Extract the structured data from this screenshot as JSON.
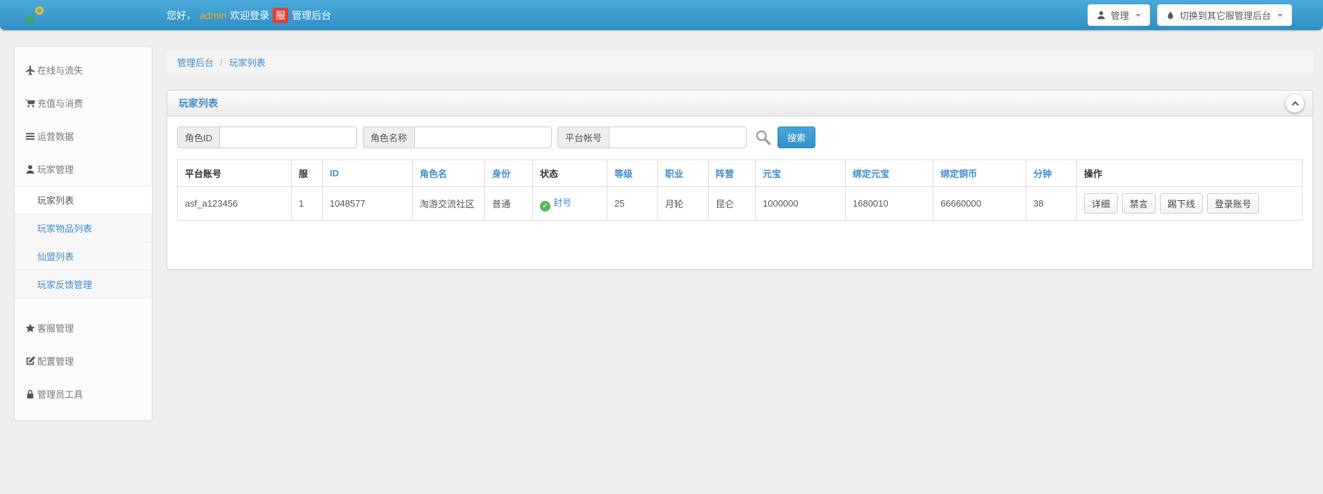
{
  "colors": {
    "navbar_blue_top": "#4aa9da",
    "navbar_blue_bottom": "#3090c5",
    "link_blue": "#428bca",
    "username_orange": "#f6a623",
    "server_badge_red": "#dd3f38",
    "status_green": "#5cb85c",
    "search_button_blue": "#3391c9"
  },
  "navbar": {
    "welcome": {
      "greeting": "您好，",
      "username": "admin",
      "message": "欢迎登录",
      "server_badge": "服",
      "suffix": "管理后台"
    },
    "manage_button": "管理",
    "switch_server_button": "切换到其它服管理后台"
  },
  "sidebar": {
    "items_top": [
      {
        "label": "在线与流失",
        "icon": "plane-icon"
      },
      {
        "label": "充值与消费",
        "icon": "cart-icon"
      },
      {
        "label": "运营数据",
        "icon": "list-icon"
      },
      {
        "label": "玩家管理",
        "icon": "user-icon"
      }
    ],
    "submenu": [
      {
        "label": "玩家列表",
        "active": true
      },
      {
        "label": "玩家物品列表",
        "active": false
      },
      {
        "label": "仙盟列表",
        "active": false
      },
      {
        "label": "玩家反馈管理",
        "active": false
      }
    ],
    "items_bottom": [
      {
        "label": "客服管理",
        "icon": "star-icon"
      },
      {
        "label": "配置管理",
        "icon": "edit-icon"
      },
      {
        "label": "管理员工具",
        "icon": "lock-icon"
      }
    ]
  },
  "breadcrumb": {
    "root": "管理后台",
    "separator": "/",
    "current": "玩家列表"
  },
  "panel": {
    "title": "玩家列表"
  },
  "search": {
    "fields": [
      {
        "label": "角色ID",
        "value": ""
      },
      {
        "label": "角色名称",
        "value": ""
      },
      {
        "label": "平台帐号",
        "value": ""
      }
    ],
    "button_label": "搜索"
  },
  "table": {
    "columns": [
      {
        "label": "平台账号",
        "link": false
      },
      {
        "label": "服",
        "link": false
      },
      {
        "label": "ID",
        "link": true
      },
      {
        "label": "角色名",
        "link": true
      },
      {
        "label": "身份",
        "link": true
      },
      {
        "label": "状态",
        "link": false
      },
      {
        "label": "等级",
        "link": true
      },
      {
        "label": "职业",
        "link": true
      },
      {
        "label": "阵营",
        "link": true
      },
      {
        "label": "元宝",
        "link": true
      },
      {
        "label": "绑定元宝",
        "link": true
      },
      {
        "label": "绑定铜币",
        "link": true
      },
      {
        "label": "分钟",
        "link": true
      },
      {
        "label": "操作",
        "link": false
      }
    ],
    "rows": [
      {
        "platform_account": "asf_a123456",
        "server": "1",
        "id": "1048577",
        "role_name": "淘游交流社区",
        "identity": "普通",
        "status": "封号",
        "level": "25",
        "job": "月轮",
        "faction": "昆仑",
        "yuanbao": "1000000",
        "bound_yuanbao": "1680010",
        "bound_copper": "66660000",
        "minutes": "38",
        "actions": [
          "详细",
          "禁言",
          "踢下线",
          "登录账号"
        ]
      }
    ]
  },
  "icons": {
    "status_check": "✓"
  }
}
